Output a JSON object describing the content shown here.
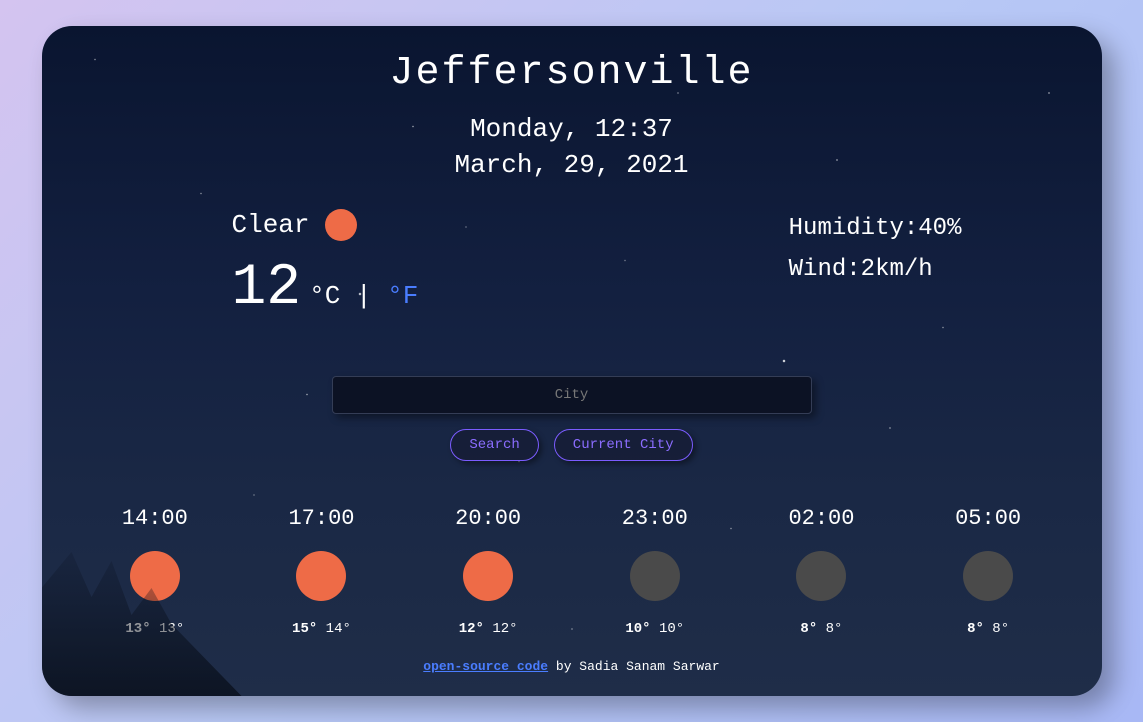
{
  "city": "Jeffersonville",
  "datetime": {
    "day_time": "Monday, 12:37",
    "date": "March, 29, 2021"
  },
  "current": {
    "condition": "Clear",
    "temp": "12",
    "unit_c": "°C",
    "divider": " | ",
    "unit_f": "°F",
    "humidity_label": "Humidity:",
    "humidity_value": "40%",
    "wind_label": "Wind:",
    "wind_value": "2km/h"
  },
  "search": {
    "placeholder": "City",
    "search_button": "Search",
    "current_city_button": "Current City"
  },
  "forecast": [
    {
      "time": "14:00",
      "icon": "day",
      "max": "13°",
      "min": "13°"
    },
    {
      "time": "17:00",
      "icon": "day",
      "max": "15°",
      "min": "14°"
    },
    {
      "time": "20:00",
      "icon": "day",
      "max": "12°",
      "min": "12°"
    },
    {
      "time": "23:00",
      "icon": "night",
      "max": "10°",
      "min": "10°"
    },
    {
      "time": "02:00",
      "icon": "night",
      "max": "8°",
      "min": "8°"
    },
    {
      "time": "05:00",
      "icon": "night",
      "max": "8°",
      "min": "8°"
    }
  ],
  "footer": {
    "link_text": "open-source code",
    "by_text": " by Sadia Sanam Sarwar"
  }
}
